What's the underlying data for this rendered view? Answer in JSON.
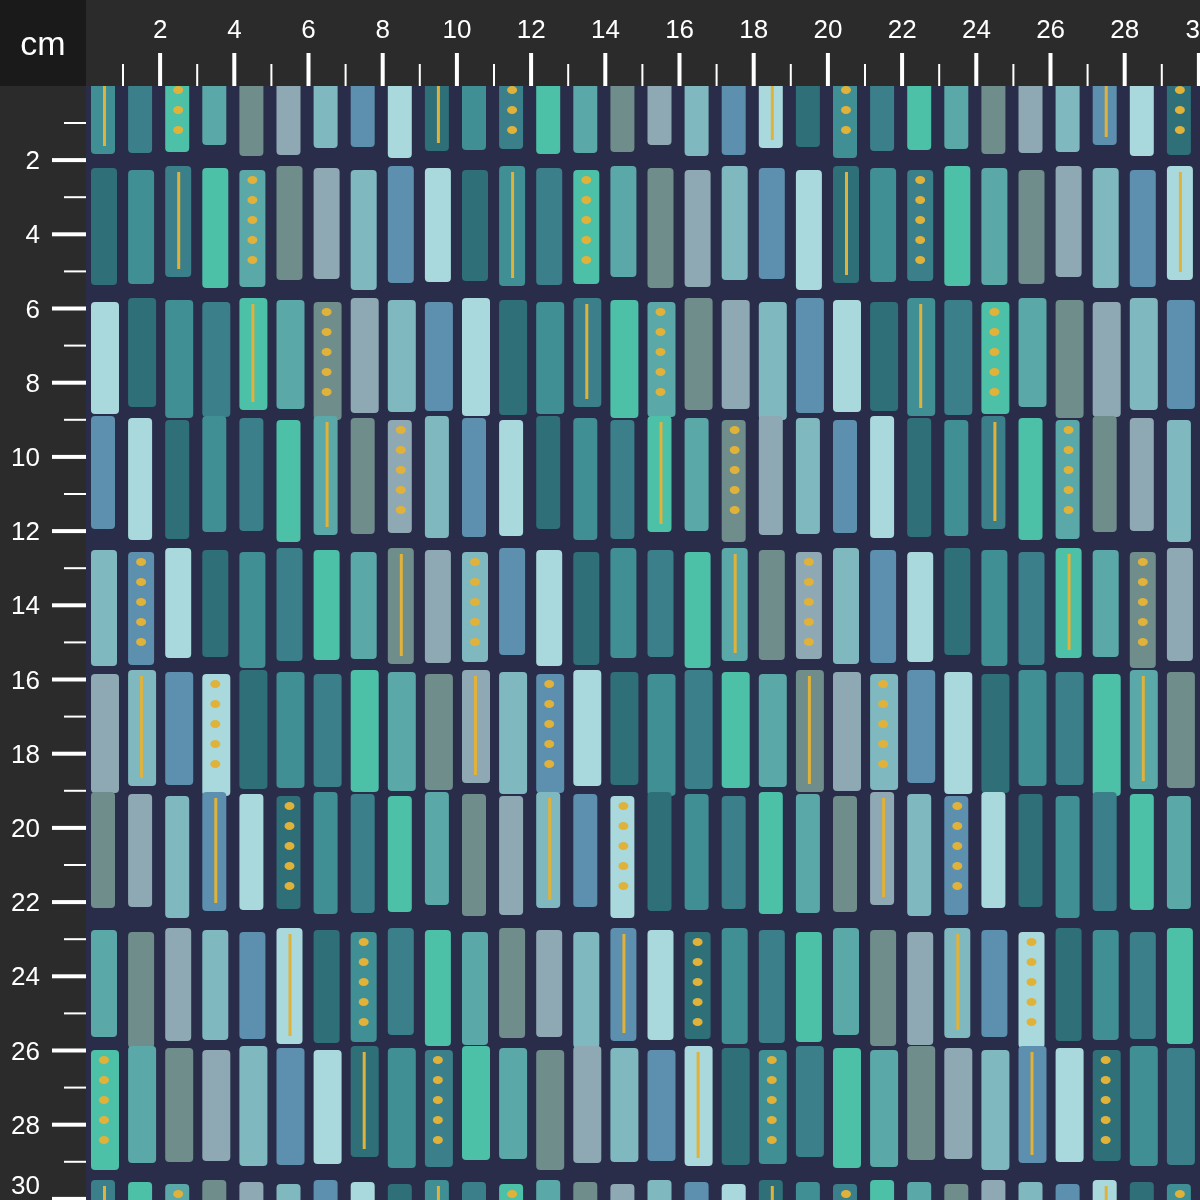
{
  "unit_label": "cm",
  "top_ruler": {
    "labels": [
      "2",
      "4",
      "6",
      "8",
      "10",
      "12",
      "14",
      "16",
      "18",
      "20",
      "22",
      "24",
      "26",
      "28",
      "3"
    ]
  },
  "left_ruler": {
    "labels": [
      "2",
      "4",
      "6",
      "8",
      "10",
      "12",
      "14",
      "16",
      "18",
      "20",
      "22",
      "24",
      "26",
      "28",
      "30"
    ]
  }
}
